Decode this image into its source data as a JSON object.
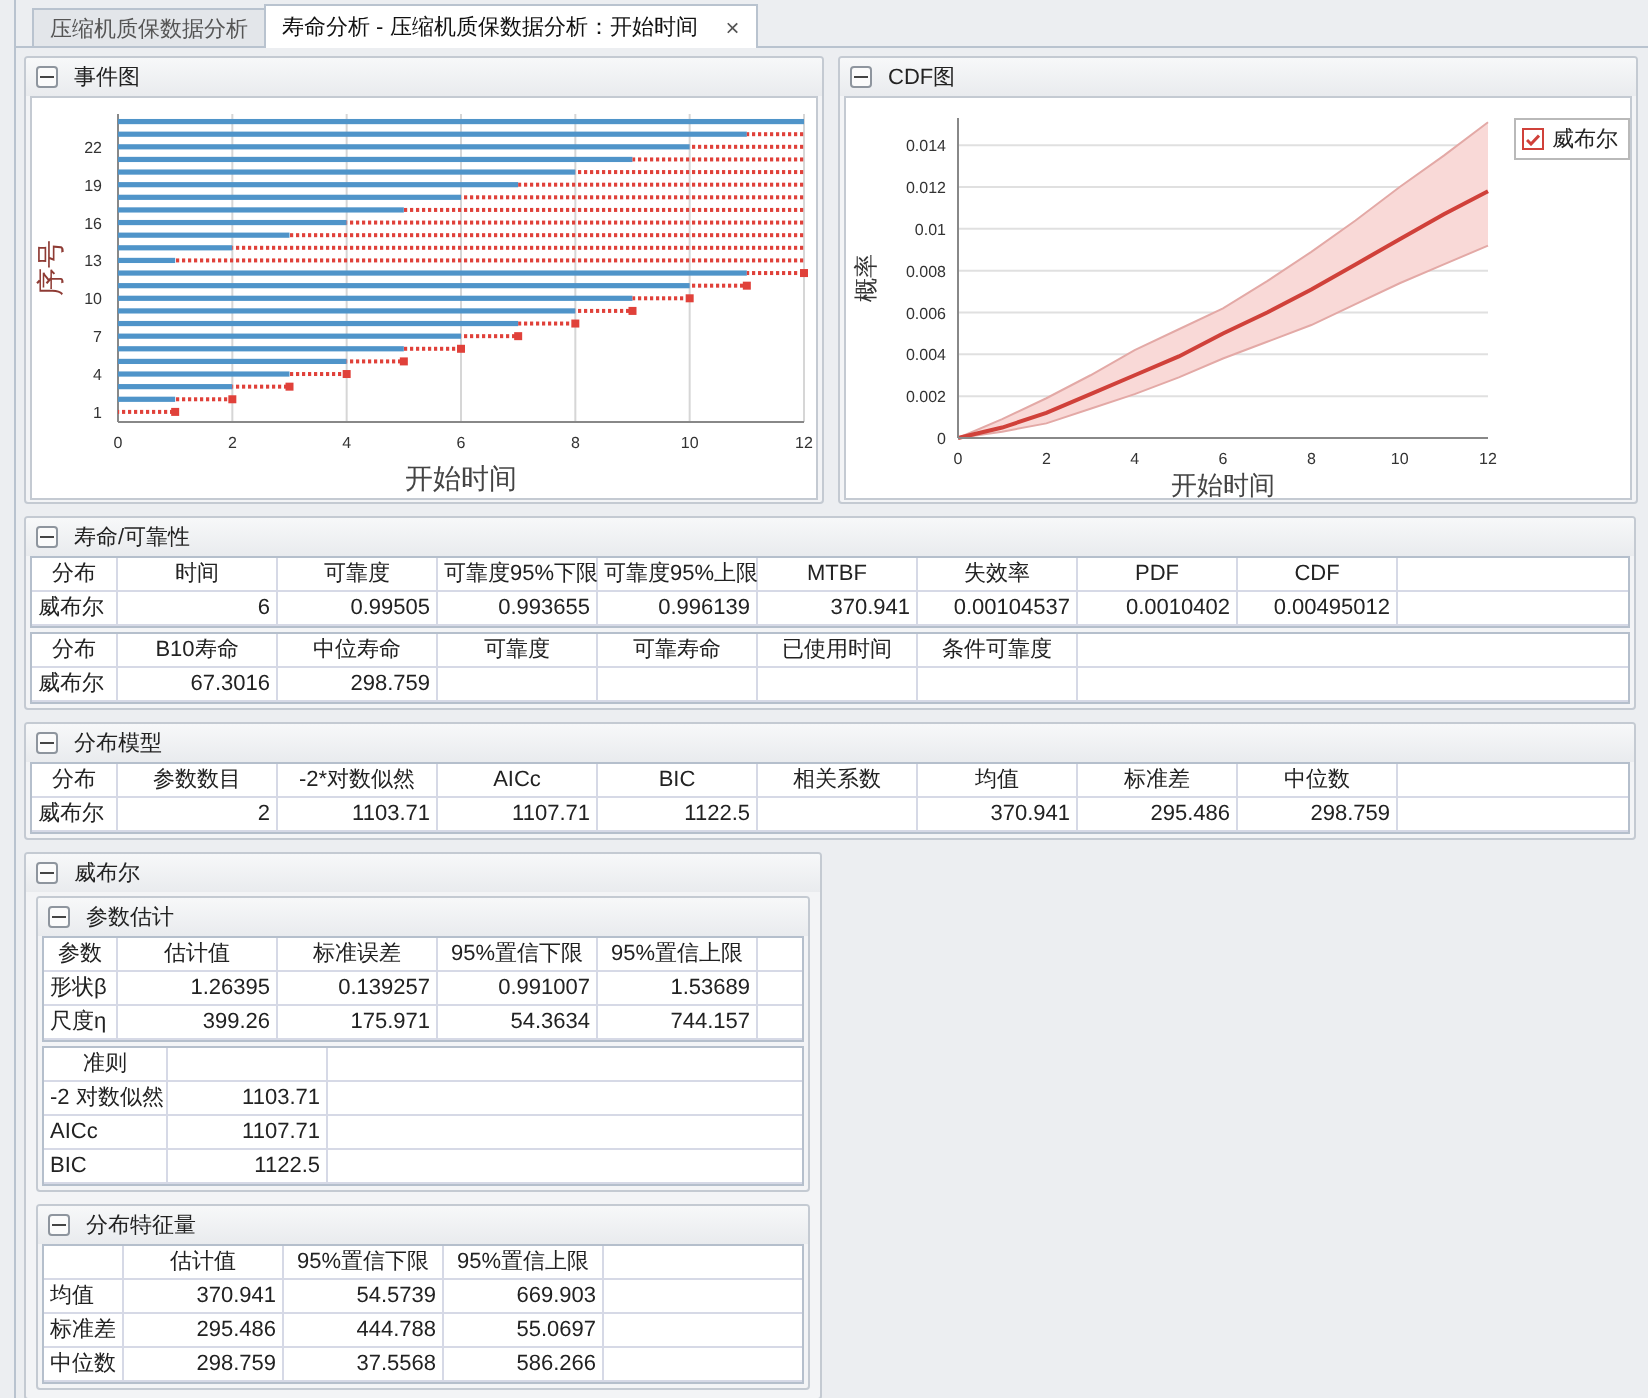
{
  "tabs": [
    {
      "label": "压缩机质保数据分析",
      "selected": false
    },
    {
      "label": "寿命分析 - 压缩机质保数据分析：开始时间",
      "selected": true,
      "close": "×"
    }
  ],
  "event_panel": {
    "title": "事件图",
    "failures": [
      false,
      false,
      false,
      false,
      false,
      false,
      false,
      false,
      false,
      false,
      false,
      false,
      true,
      true,
      true,
      true,
      true,
      true,
      true,
      true,
      true,
      true,
      true,
      true
    ],
    "chart_data": {
      "type": "bar",
      "orientation": "horizontal",
      "stacked": true,
      "grid": true,
      "xlabel": "开始时间",
      "ylabel": "序号",
      "categories": [
        null,
        null,
        "22",
        null,
        null,
        "19",
        null,
        null,
        "16",
        null,
        null,
        "13",
        null,
        null,
        "10",
        null,
        null,
        "7",
        null,
        null,
        "4",
        null,
        null,
        "1"
      ],
      "series": [
        {
          "color": "#4f94c9",
          "values": [
            12,
            11,
            10,
            9,
            8,
            7,
            6,
            5,
            4,
            3,
            2,
            1,
            11,
            10,
            9,
            8,
            7,
            6,
            5,
            4,
            3,
            2,
            1,
            0
          ]
        },
        {
          "color": "#e0413a",
          "values": [
            0,
            1,
            2,
            3,
            4,
            5,
            6,
            7,
            8,
            9,
            10,
            11,
            1,
            1,
            1,
            1,
            1,
            1,
            1,
            1,
            1,
            1,
            1,
            1
          ]
        }
      ],
      "xlim": [
        0,
        12
      ],
      "xticks": [
        0,
        2,
        4,
        6,
        8,
        10,
        12
      ]
    }
  },
  "cdf_panel": {
    "title": "CDF图",
    "legend": [
      {
        "checked": true
      }
    ],
    "chart_data": {
      "type": "line",
      "grid": true,
      "xlabel": "开始时间",
      "ylabel": "概率",
      "x": [
        0,
        1,
        2,
        3,
        4,
        5,
        6,
        7,
        8,
        9,
        10,
        11,
        12
      ],
      "series": [
        {
          "name": "威布尔",
          "color": "#d0413a",
          "values": [
            0,
            0.0005,
            0.0012,
            0.0021,
            0.003,
            0.0039,
            0.005,
            0.006,
            0.0071,
            0.0083,
            0.0095,
            0.0107,
            0.0118
          ]
        },
        {
          "color": "#e3a9a6",
          "values": [
            0,
            0.0009,
            0.0019,
            0.003,
            0.0042,
            0.0052,
            0.0062,
            0.0075,
            0.0089,
            0.0104,
            0.012,
            0.0135,
            0.0151
          ]
        },
        {
          "color": "#e3a9a6",
          "values": [
            0,
            0.0003,
            0.0007,
            0.0014,
            0.0021,
            0.0029,
            0.0038,
            0.0046,
            0.0054,
            0.0064,
            0.0074,
            0.0083,
            0.0092
          ]
        }
      ],
      "xlim": [
        0,
        12
      ],
      "ylim": [
        0,
        0.0153
      ],
      "xticks": [
        0,
        2,
        4,
        6,
        8,
        10,
        12
      ],
      "yticks": [
        0,
        0.002,
        0.004,
        0.006,
        0.008,
        0.01,
        0.012,
        0.014
      ]
    }
  },
  "life_panel": {
    "title": "寿命/可靠性",
    "tables": [
      {
        "columns": [
          "分布",
          "时间",
          "可靠度",
          "可靠度95%下限",
          "可靠度95%上限",
          "MTBF",
          "失效率",
          "PDF",
          "CDF"
        ],
        "rows": [
          [
            "威布尔",
            "6",
            "0.99505",
            "0.993655",
            "0.996139",
            "370.941",
            "0.00104537",
            "0.0010402",
            "0.00495012"
          ]
        ]
      },
      {
        "columns": [
          "分布",
          "B10寿命",
          "中位寿命",
          "可靠度",
          "可靠寿命",
          "已使用时间",
          "条件可靠度"
        ],
        "rows": [
          [
            "威布尔",
            "67.3016",
            "298.759",
            null,
            null,
            null,
            null
          ]
        ]
      }
    ]
  },
  "model_panel": {
    "title": "分布模型",
    "tables": [
      {
        "columns": [
          "分布",
          "参数数目",
          "-2*对数似然",
          "AICc",
          "BIC",
          "相关系数",
          "均值",
          "标准差",
          "中位数"
        ],
        "rows": [
          [
            "威布尔",
            "2",
            "1103.71",
            "1107.71",
            "1122.5",
            null,
            "370.941",
            "295.486",
            "298.759"
          ]
        ]
      }
    ]
  },
  "weibull_panel": {
    "title": "威布尔",
    "sections": [
      {
        "title": "参数估计",
        "tables": [
          {
            "columns": [
              "参数",
              "估计值",
              "标准误差",
              "95%置信下限",
              "95%置信上限"
            ],
            "rows": [
              [
                "形状β",
                "1.26395",
                "0.139257",
                "0.991007",
                "1.53689"
              ],
              [
                "尺度η",
                "399.26",
                "175.971",
                "54.3634",
                "744.157"
              ]
            ]
          },
          {
            "columns": [
              "准则",
              null
            ],
            "rows": [
              [
                "-2 对数似然",
                "1103.71"
              ],
              [
                "AICc",
                "1107.71"
              ],
              [
                "BIC",
                "1122.5"
              ]
            ]
          }
        ]
      },
      {
        "title": "分布特征量",
        "tables": [
          {
            "columns": [
              null,
              "估计值",
              "95%置信下限",
              "95%置信上限"
            ],
            "rows": [
              [
                "均值",
                "370.941",
                "54.5739",
                "669.903"
              ],
              [
                "标准差",
                "295.486",
                "444.788",
                "55.0697"
              ],
              [
                "中位数",
                "298.759",
                "37.5568",
                "586.266"
              ]
            ]
          }
        ]
      }
    ]
  }
}
